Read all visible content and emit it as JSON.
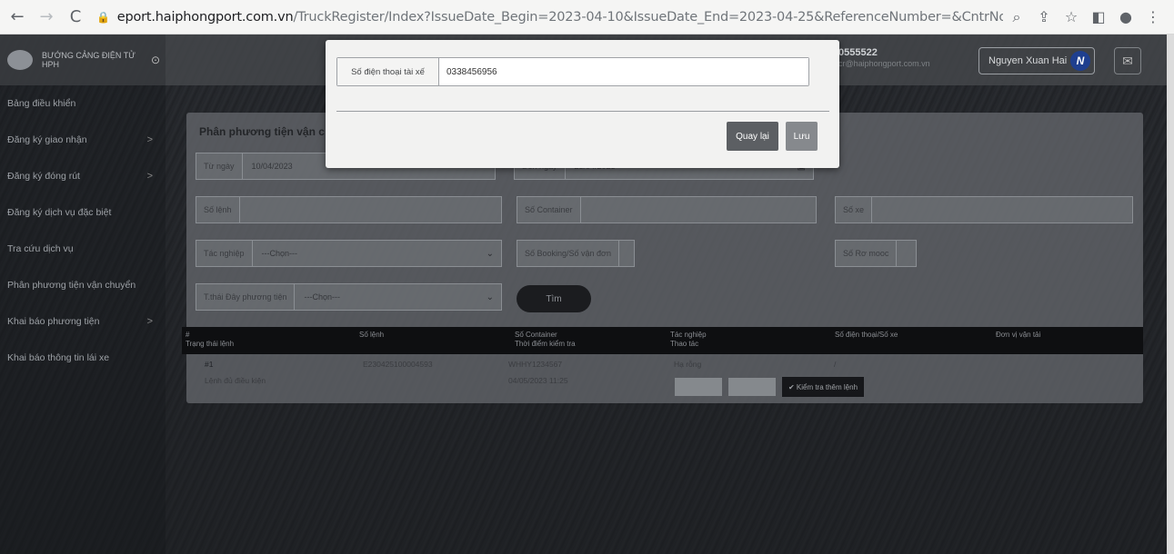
{
  "browser": {
    "url_host": "eport.haiphongport.com.vn",
    "url_path": "/TruckRegister/Index?IssueDate_Begin=2023-04-10&IssueDate_End=2023-04-25&ReferenceNumber=&CntrNo=&TruckNo=&CJMode...",
    "back_icon": "←",
    "forward_icon": "→",
    "reload_icon": "C",
    "icons": [
      "zoom-icon",
      "share-icon",
      "star-icon",
      "sidepanel-icon",
      "profile-icon",
      "menu-icon"
    ]
  },
  "brand": {
    "name": "BƯỚNG CẢNG ĐIỆN TỬ HPH",
    "toggle": "⊙"
  },
  "sidebar": {
    "items": [
      {
        "label": "Bảng điều khiển",
        "chev": ""
      },
      {
        "label": "Đăng ký giao nhận",
        "chev": ">"
      },
      {
        "label": "Đăng ký đóng rút",
        "chev": ">"
      },
      {
        "label": "Đăng ký dịch vụ đặc biệt",
        "chev": ""
      },
      {
        "label": "Tra cứu dịch vụ",
        "chev": ""
      },
      {
        "label": "Phân phương tiện vận chuyển",
        "chev": ""
      },
      {
        "label": "Khai báo phương tiện",
        "chev": ">"
      },
      {
        "label": "Khai báo thông tin lái xe",
        "chev": ""
      }
    ]
  },
  "header": {
    "phone": "0555522",
    "email": "cr@haiphongport.com.vn",
    "user": "Nguyen Xuan Hai",
    "avatar": "N"
  },
  "panel": {
    "title": "Phân phương tiện vận c",
    "from_label": "Từ ngày",
    "from_value": "10/04/2023",
    "to_label": "Đến ngày",
    "to_value": "25/04/2023",
    "so_lenh": "Số lệnh",
    "so_container": "Số Container",
    "so_xe": "Số xe",
    "tac_nghiep_label": "Tác nghiệp",
    "tac_nghiep_value": "---Chọn---",
    "so_booking": "Số Booking/Số vận đơn",
    "so_ro_mooc": "Số Rơ mooc",
    "tinh_trang_label": "T.thái Đây phương tiện",
    "tinh_trang_value": "---Chọn---",
    "search_button": "Tìm"
  },
  "table": {
    "headers": {
      "c1a": "#",
      "c1b": "Trạng thái lệnh",
      "c2a": "Số lệnh",
      "c3a": "Số Container",
      "c3b": "Thời điểm kiểm tra",
      "c4a": "Tác nghiệp",
      "c4b": "Thao tác",
      "c5a": "Số điện thoại/Số xe",
      "c6a": "Đơn vị vận tải"
    },
    "row": {
      "index": "#1",
      "status": "Lệnh đủ điều kiện",
      "order": "E230425100004593",
      "container": "WHHY1234567",
      "checked_at": "04/05/2023 11:25",
      "operation": "Hạ rỗng",
      "phone": "/",
      "check_button": "✔ Kiểm tra thêm lệnh"
    }
  },
  "modal": {
    "label": "Số điện thoại tài xế",
    "value": "0338456956",
    "back_button": "Quay lại",
    "save_button": "Lưu"
  }
}
